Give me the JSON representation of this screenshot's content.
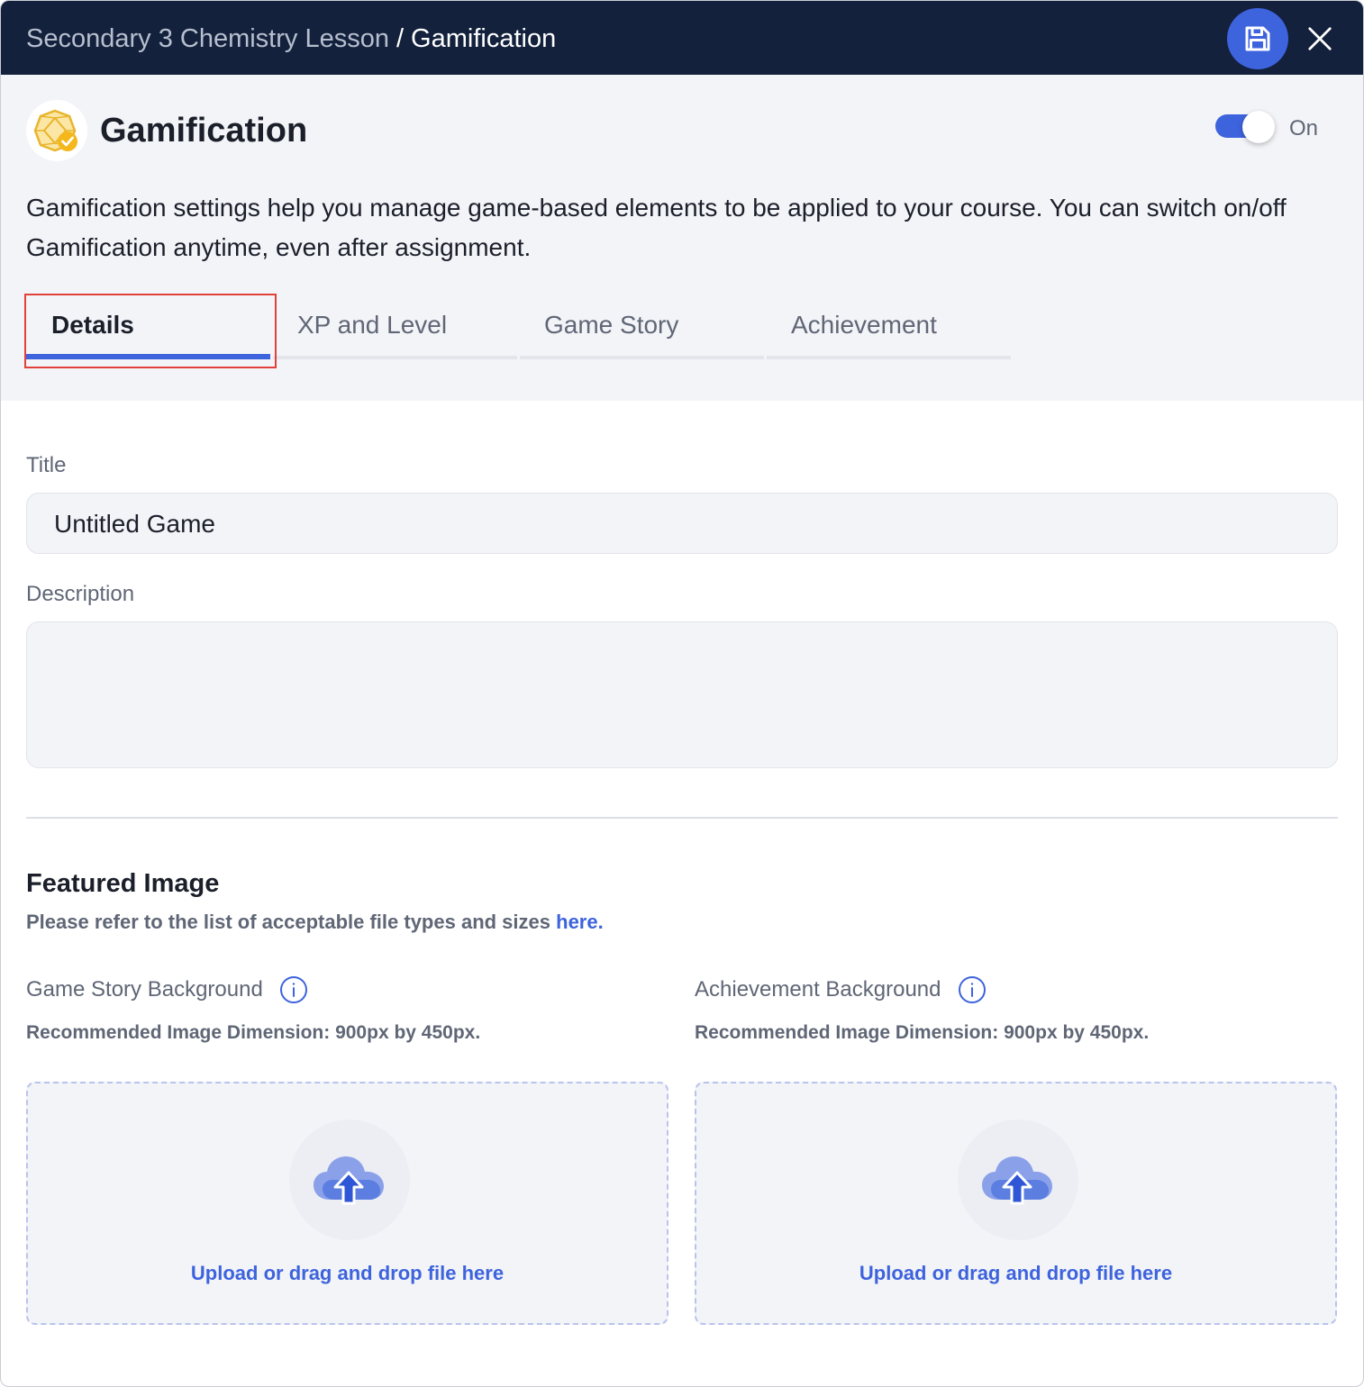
{
  "header": {
    "breadcrumb_parent": "Secondary 3 Chemistry Lesson",
    "breadcrumb_separator": "/",
    "breadcrumb_current": "Gamification",
    "save_icon": "save-icon",
    "close_icon": "close-icon"
  },
  "page": {
    "title": "Gamification",
    "logo_icon": "gamification-badge-icon",
    "toggle_label": "On",
    "toggle_on": true,
    "intro": "Gamification settings help you manage game-based elements to be applied to your course. You can switch on/off Gamification anytime, even after assignment."
  },
  "tabs": [
    {
      "label": "Details",
      "active": true
    },
    {
      "label": "XP and Level",
      "active": false
    },
    {
      "label": "Game Story",
      "active": false
    },
    {
      "label": "Achievement",
      "active": false
    }
  ],
  "form": {
    "title_label": "Title",
    "title_value": "Untitled Game",
    "description_label": "Description",
    "description_value": ""
  },
  "featured": {
    "title": "Featured Image",
    "note": "Please refer to the list of acceptable file types and sizes ",
    "note_link": "here.",
    "uploads": [
      {
        "label": "Game Story Background",
        "hint": "Recommended Image Dimension: 900px by 450px.",
        "dropzone_text": "Upload or drag and drop file here"
      },
      {
        "label": "Achievement Background",
        "hint": "Recommended Image Dimension: 900px by 450px.",
        "dropzone_text": "Upload or drag and drop file here"
      }
    ]
  },
  "colors": {
    "topbar": "#13213c",
    "accent": "#3d63dd",
    "panel": "#f3f4f8",
    "highlight": "#e2413a"
  }
}
